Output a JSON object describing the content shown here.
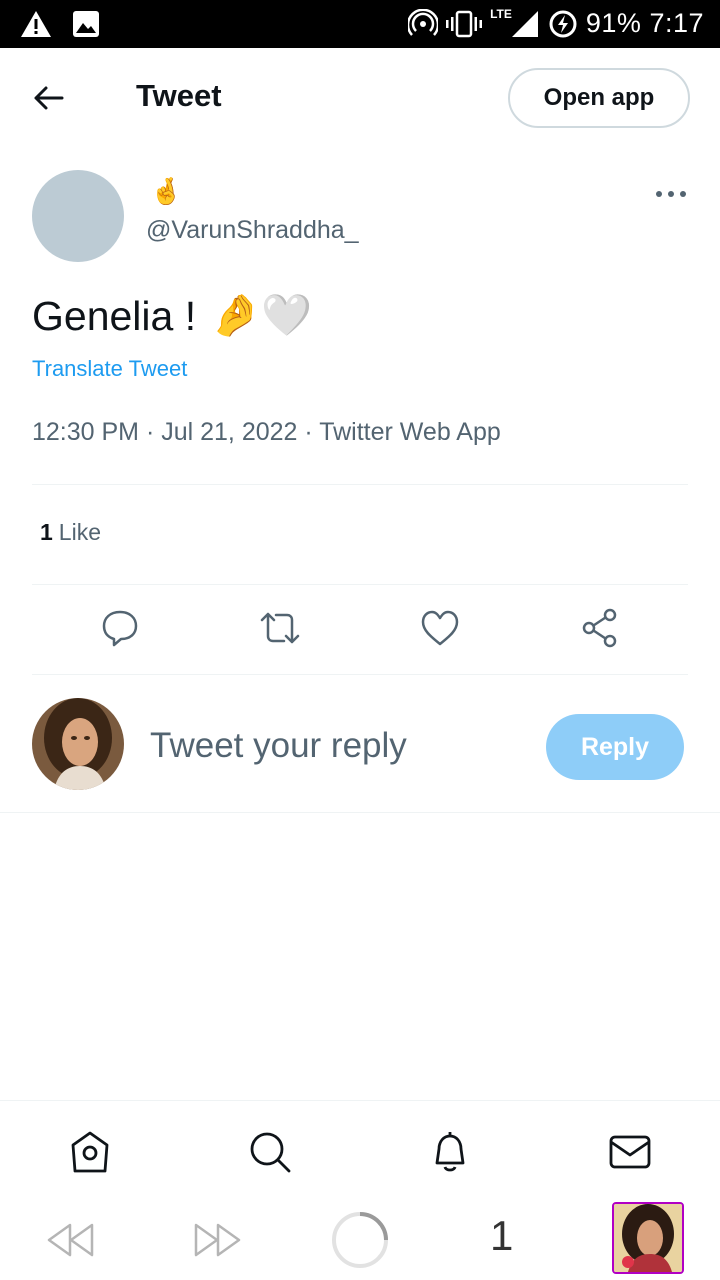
{
  "status_bar": {
    "battery": "91%",
    "time": "7:17",
    "network": "LTE",
    "icons": [
      "warning-icon",
      "image-icon",
      "hotspot-icon",
      "vibrate-icon",
      "signal-icon",
      "data-saver-icon"
    ]
  },
  "top_bar": {
    "title": "Tweet",
    "open_app_label": "Open app",
    "back_icon": "arrow-left-icon"
  },
  "tweet": {
    "author_name": "🤞",
    "author_handle": "@VarunShraddha_",
    "text": "Genelia !",
    "text_emojis": "🤌🤍",
    "translate_label": "Translate Tweet",
    "meta": "12:30 PM · Jul 21, 2022 · Twitter Web App",
    "like_count": "1",
    "like_label": "Like",
    "more_icon": "more-horizontal-icon"
  },
  "actions": [
    "reply-icon",
    "retweet-icon",
    "like-icon",
    "share-icon"
  ],
  "reply": {
    "placeholder": "Tweet your reply",
    "button_label": "Reply"
  },
  "bottom_nav": [
    "home-icon",
    "search-icon",
    "notifications-icon",
    "messages-icon"
  ],
  "browser_bar": {
    "tab_count": "1",
    "icons": [
      "rewind-icon",
      "fast-forward-icon",
      "loading-icon",
      "tab-thumbnail"
    ]
  },
  "colors": {
    "accent": "#1d9bf0",
    "reply_button": "#8ecdf8",
    "secondary_text": "#536471",
    "divider": "#eff3f4",
    "avatar_placeholder": "#bccbd4"
  }
}
